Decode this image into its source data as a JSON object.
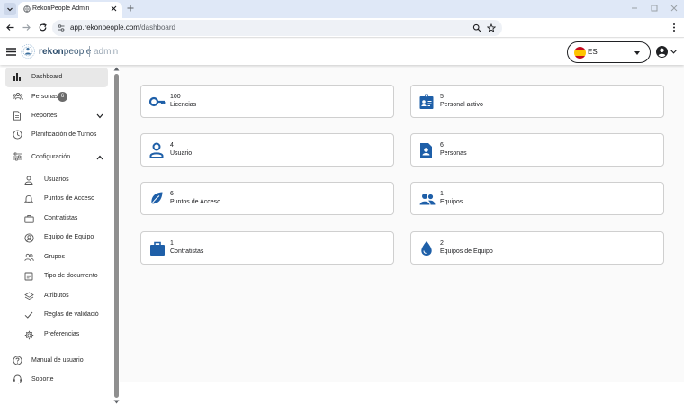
{
  "browser": {
    "tab_title": "RekonPeople Admin",
    "url_host": "app.rekonpeople.com",
    "url_path": "/dashboard"
  },
  "header": {
    "logo_bold": "rekon",
    "logo_rest": "people",
    "logo_admin": "admin",
    "language": "ES"
  },
  "sidebar": {
    "dashboard": "Dashboard",
    "personas": "Personas",
    "personas_badge": "6",
    "reportes": "Reportes",
    "planificacion": "Planificación de Turnos",
    "configuracion": "Configuración",
    "sub": {
      "usuarios": "Usuarios",
      "puntos": "Puntos de Acceso",
      "contratistas": "Contratistas",
      "equipo_de_equipo": "Equipo de Equipo",
      "grupos": "Grupos",
      "tipo_documento": "Tipo de documento",
      "atributos": "Atributos",
      "reglas": "Reglas de validació",
      "preferencias": "Preferencias"
    },
    "manual": "Manual de usuario",
    "soporte": "Soporte"
  },
  "cards": [
    {
      "count": "100",
      "label": "Licencias",
      "icon": "key-icon"
    },
    {
      "count": "5",
      "label": "Personal activo",
      "icon": "id-card-icon"
    },
    {
      "count": "4",
      "label": "Usuario",
      "icon": "user-icon"
    },
    {
      "count": "6",
      "label": "Personas",
      "icon": "contact-file-icon"
    },
    {
      "count": "6",
      "label": "Puntos de Acceso",
      "icon": "leaf-icon"
    },
    {
      "count": "1",
      "label": "Equipos",
      "icon": "people-icon"
    },
    {
      "count": "1",
      "label": "Contratistas",
      "icon": "briefcase-icon"
    },
    {
      "count": "2",
      "label": "Equipos de Equipo",
      "icon": "drop-icon"
    }
  ],
  "colors": {
    "accent": "#1e5fa8",
    "active_nav": "#e8e8e8",
    "card_border": "#cfcfcf",
    "tabbar": "#dfe8f7"
  }
}
